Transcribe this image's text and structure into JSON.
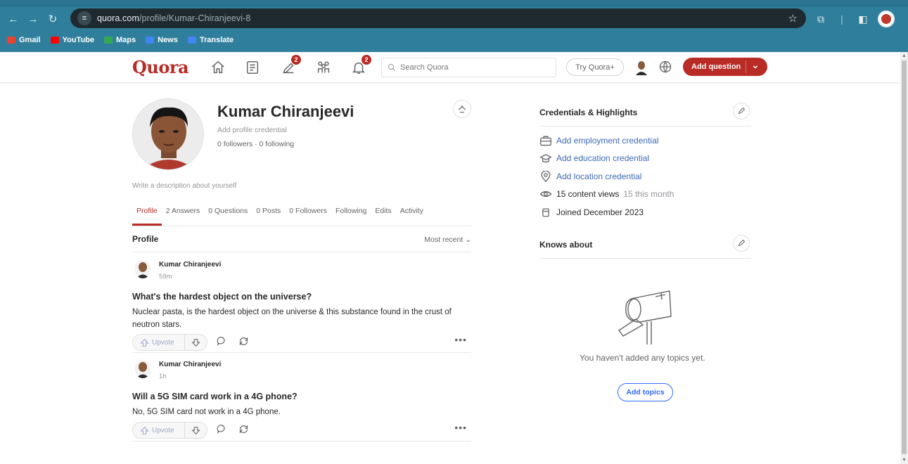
{
  "browser": {
    "url_host": "quora.com",
    "url_path": "/profile/Kumar-Chiranjeevi-8",
    "bookmarks": [
      {
        "label": "Gmail",
        "color": "#e94235"
      },
      {
        "label": "YouTube",
        "color": "#ff0000"
      },
      {
        "label": "Maps",
        "color": "#34a853"
      },
      {
        "label": "News",
        "color": "#4285f4"
      },
      {
        "label": "Translate",
        "color": "#4285f4"
      }
    ]
  },
  "header": {
    "logo": "Quora",
    "notifications": {
      "answer_badge": "2",
      "bell_badge": "2"
    },
    "search_placeholder": "Search Quora",
    "try_label": "Try Quora+",
    "add_question_label": "Add question",
    "brand_color": "#b92b27"
  },
  "profile": {
    "name": "Kumar Chiranjeevi",
    "credential_prompt": "Add profile credential",
    "follow_stats": "0 followers · 0 following",
    "description_prompt": "Write a description about yourself"
  },
  "tabs": [
    {
      "label": "Profile",
      "active": true
    },
    {
      "label": "2 Answers"
    },
    {
      "label": "0 Questions"
    },
    {
      "label": "0 Posts"
    },
    {
      "label": "0 Followers"
    },
    {
      "label": "Following"
    },
    {
      "label": "Edits"
    },
    {
      "label": "Activity"
    }
  ],
  "feed": {
    "title": "Profile",
    "sort_label": "Most recent",
    "posts": [
      {
        "author": "Kumar Chiranjeevi",
        "time": "59m",
        "question": "What's the hardest object on the universe?",
        "answer": "Nuclear pasta, is the hardest object on the universe & this substance found in the crust of neutron stars.",
        "upvote_label": "Upvote"
      },
      {
        "author": "Kumar Chiranjeevi",
        "time": "1h",
        "question": "Will a 5G SIM card work in a 4G phone?",
        "answer": "No, 5G SIM card not work in a 4G phone.",
        "upvote_label": "Upvote"
      }
    ],
    "more_label": "•••"
  },
  "sidebar": {
    "credentials_title": "Credentials & Highlights",
    "employment": "Add employment credential",
    "education": "Add education credential",
    "location": "Add location credential",
    "views": "15 content views",
    "views_month": "15 this month",
    "joined": "Joined December 2023",
    "knows_title": "Knows about",
    "empty_message": "You haven't added any topics yet.",
    "add_topics_label": "Add topics"
  }
}
